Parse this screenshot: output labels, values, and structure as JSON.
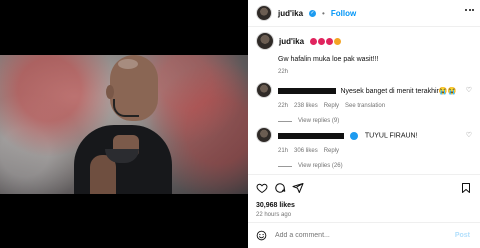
{
  "post": {
    "username": "jud'ika",
    "follow_label": "Follow",
    "caption_username": "jud'ika",
    "caption_text": "Gw hafalin muka loe pak wasit!!!",
    "caption_time": "22h",
    "likes": "30,968 likes",
    "posted_ago": "22 hours ago"
  },
  "comments": [
    {
      "text": "Nyesek banget di menit terakhir😭😭",
      "time": "22h",
      "likes": "238 likes",
      "reply_label": "Reply",
      "see_translation": "See translation",
      "view_replies": "View replies (9)"
    },
    {
      "text": "TUYUL FIRAUN!",
      "time": "21h",
      "likes": "306 likes",
      "reply_label": "Reply",
      "view_replies": "View replies (26)"
    }
  ],
  "composer": {
    "placeholder": "Add a comment...",
    "post_label": "Post"
  },
  "icons": {
    "like": "heart-icon",
    "comment": "comment-icon",
    "share": "send-icon",
    "save": "bookmark-icon",
    "more": "more-options-icon",
    "emoji": "emoji-icon"
  },
  "colors": {
    "accent": "#0095f6",
    "verified": "#1d9bf0",
    "muted": "#737373"
  }
}
